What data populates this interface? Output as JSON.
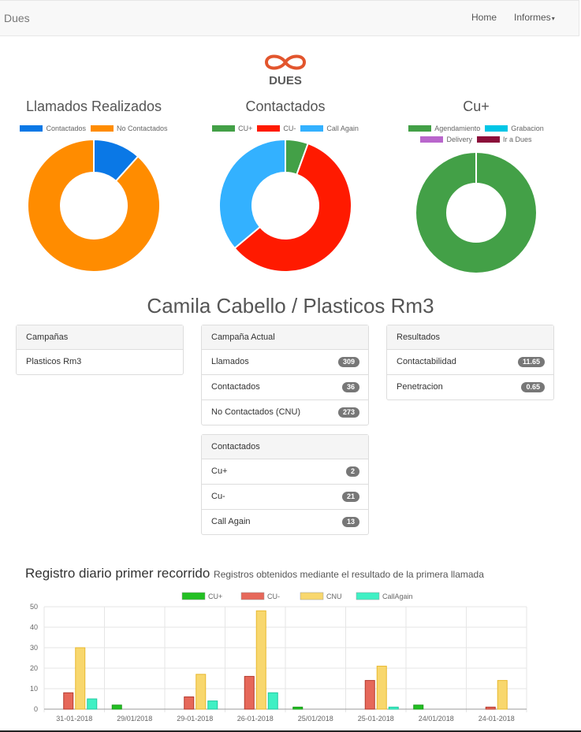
{
  "navbar": {
    "brand": "Dues",
    "home": "Home",
    "reports": "Informes"
  },
  "logo": {
    "text": "DUES",
    "color": "#e2552d"
  },
  "donuts": [
    {
      "title": "Llamados Realizados",
      "legend": [
        {
          "label": "Contactados",
          "color": "#0a78e6"
        },
        {
          "label": "No Contactados",
          "color": "#ff8c00"
        }
      ],
      "values": [
        36,
        273
      ]
    },
    {
      "title": "Contactados",
      "legend": [
        {
          "label": "CU+",
          "color": "#43a047"
        },
        {
          "label": "CU-",
          "color": "#ff1a00"
        },
        {
          "label": "Call Again",
          "color": "#33b1ff"
        }
      ],
      "values": [
        2,
        21,
        13
      ]
    },
    {
      "title": "Cu+",
      "legend": [
        {
          "label": "Agendamiento",
          "color": "#43a047"
        },
        {
          "label": "Grabacion",
          "color": "#00c6e6"
        },
        {
          "label": "Delivery",
          "color": "#b966cc"
        },
        {
          "label": "Ir a Dues",
          "color": "#8b0f3a"
        }
      ],
      "values": [
        2,
        0,
        0,
        0
      ]
    }
  ],
  "agent_title": "Camila Cabello / Plasticos Rm3",
  "panels": {
    "campanas": {
      "heading": "Campañas",
      "rows": [
        {
          "label": "Plasticos Rm3"
        }
      ]
    },
    "actual": {
      "heading": "Campaña Actual",
      "rows": [
        {
          "label": "Llamados",
          "badge": "309"
        },
        {
          "label": "Contactados",
          "badge": "36"
        },
        {
          "label": "No Contactados (CNU)",
          "badge": "273"
        }
      ]
    },
    "resultados": {
      "heading": "Resultados",
      "rows": [
        {
          "label": "Contactabilidad",
          "badge": "11.65"
        },
        {
          "label": "Penetracion",
          "badge": "0.65"
        }
      ]
    },
    "contactados": {
      "heading": "Contactados",
      "rows": [
        {
          "label": "Cu+",
          "badge": "2"
        },
        {
          "label": "Cu-",
          "badge": "21"
        },
        {
          "label": "Call Again",
          "badge": "13"
        }
      ]
    }
  },
  "daily": {
    "title": "Registro diario primer recorrido",
    "subtitle": "Registros obtenidos mediante el resultado de la primera llamada"
  },
  "chart_data": {
    "type": "bar",
    "categories": [
      "31-01-2018",
      "29/01/2018",
      "29-01-2018",
      "26-01-2018",
      "25/01/2018",
      "25-01-2018",
      "24/01/2018",
      "24-01-2018"
    ],
    "series": [
      {
        "name": "CU+",
        "color": "#22c022",
        "values": [
          0,
          2,
          0,
          0,
          1,
          0,
          2,
          0
        ]
      },
      {
        "name": "CU-",
        "color": "#e6685a",
        "values": [
          8,
          0,
          6,
          16,
          0,
          14,
          0,
          1
        ]
      },
      {
        "name": "CNU",
        "color": "#f8d76d",
        "values": [
          30,
          0,
          17,
          48,
          0,
          21,
          0,
          14
        ]
      },
      {
        "name": "CallAgain",
        "color": "#3ff0c4",
        "values": [
          5,
          0,
          4,
          8,
          0,
          1,
          0,
          0
        ]
      }
    ],
    "ylim": [
      0,
      50
    ],
    "yticks": [
      0,
      10,
      20,
      30,
      40,
      50
    ],
    "grid": true,
    "legend": "top"
  }
}
